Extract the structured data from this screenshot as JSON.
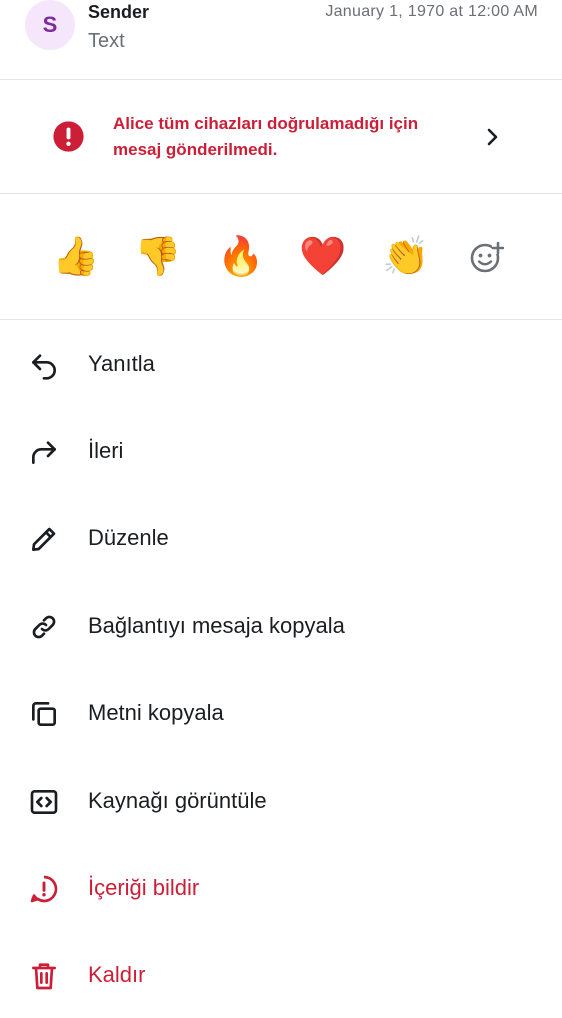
{
  "message": {
    "avatar_letter": "S",
    "sender": "Sender",
    "text": "Text",
    "timestamp": "January 1, 1970 at 12:00 AM"
  },
  "error_banner": {
    "line1": "Alice tüm cihazları doğrulamadığı için",
    "line2": "mesaj gönderilmedi.",
    "color": "#cc1f37"
  },
  "reactions": [
    {
      "emoji": "👍",
      "name": "thumbs-up"
    },
    {
      "emoji": "👎",
      "name": "thumbs-down"
    },
    {
      "emoji": "🔥",
      "name": "fire"
    },
    {
      "emoji": "❤️",
      "name": "heart"
    },
    {
      "emoji": "👏",
      "name": "clapping"
    }
  ],
  "menu": [
    {
      "label": "Yanıtla",
      "icon": "reply-icon"
    },
    {
      "label": "İleri",
      "icon": "forward-icon"
    },
    {
      "label": "Düzenle",
      "icon": "pencil-icon"
    },
    {
      "label": "Bağlantıyı mesaja kopyala",
      "icon": "link-icon"
    },
    {
      "label": "Metni kopyala",
      "icon": "copy-icon"
    },
    {
      "label": "Kaynağı görüntüle",
      "icon": "code-icon"
    },
    {
      "label": "İçeriği bildir",
      "icon": "report-icon"
    },
    {
      "label": "Kaldır",
      "icon": "trash-icon"
    }
  ],
  "colors": {
    "danger": "#cc1f37",
    "text": "#1b1d22",
    "secondary": "#6b6f76",
    "avatar_bg": "#f5e6fb",
    "avatar_fg": "#7b2b9e"
  }
}
